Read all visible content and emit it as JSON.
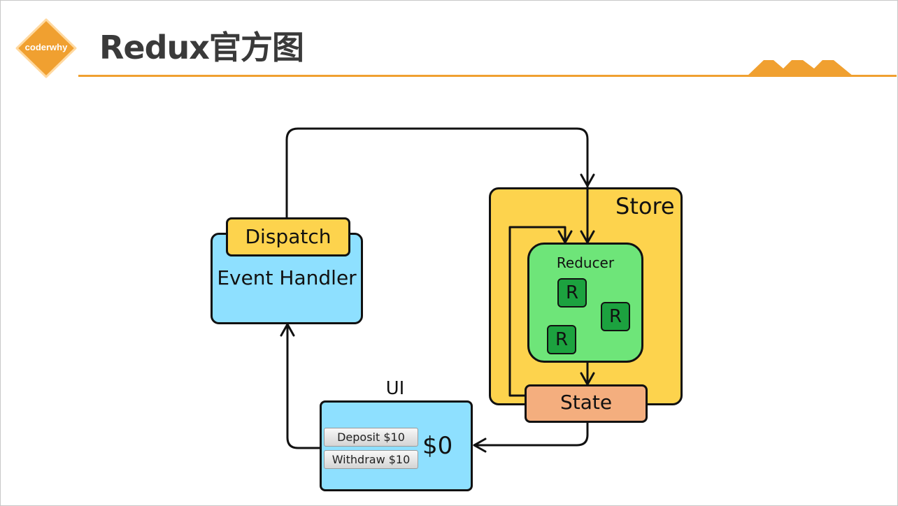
{
  "header": {
    "logo_text": "coderwhy",
    "title": "Redux官方图"
  },
  "diagram": {
    "store_label": "Store",
    "reducer_label": "Reducer",
    "reducer_chips": [
      "R",
      "R",
      "R"
    ],
    "state_label": "State",
    "dispatch_label": "Dispatch",
    "event_handler_label": "Event Handler",
    "ui_label": "UI",
    "deposit_button": "Deposit $10",
    "withdraw_button": "Withdraw $10",
    "balance": "$0"
  },
  "colors": {
    "accent": "#f0a030",
    "store": "#fdd34d",
    "reducer": "#6ee579",
    "reducer_chip": "#1ca23f",
    "state": "#f4ae7e",
    "ui_blue": "#8ee0ff"
  }
}
